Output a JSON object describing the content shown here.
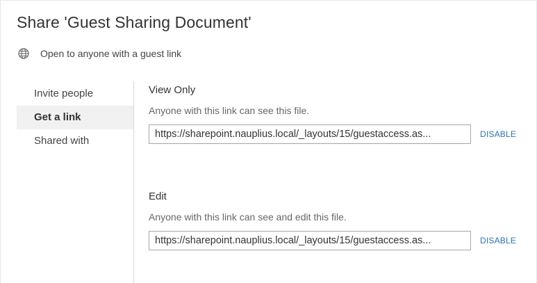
{
  "dialog": {
    "title": "Share 'Guest Sharing Document'",
    "status": {
      "icon": "globe-icon",
      "text": "Open to anyone with a guest link"
    }
  },
  "nav": {
    "items": [
      {
        "label": "Invite people",
        "selected": false
      },
      {
        "label": "Get a link",
        "selected": true
      },
      {
        "label": "Shared with",
        "selected": false
      }
    ]
  },
  "links": {
    "view": {
      "title": "View Only",
      "description": "Anyone with this link can see this file.",
      "url": "https://sharepoint.nauplius.local/_layouts/15/guestaccess.as...",
      "disable_label": "DISABLE"
    },
    "edit": {
      "title": "Edit",
      "description": "Anyone with this link can see and edit this file.",
      "url": "https://sharepoint.nauplius.local/_layouts/15/guestaccess.as...",
      "disable_label": "DISABLE"
    }
  },
  "colors": {
    "accent": "#2a72b8",
    "selected_bg": "#f1f1f1",
    "divider": "#d6d6d6"
  }
}
